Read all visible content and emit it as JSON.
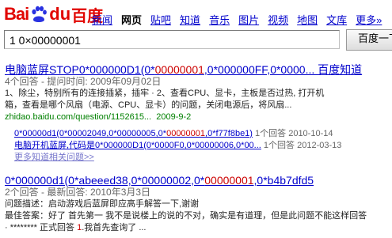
{
  "logo": {
    "bai": "Bai",
    "du": "du",
    "cn": "百度"
  },
  "nav": [
    "新闻",
    "网页",
    "贴吧",
    "知道",
    "音乐",
    "图片",
    "视频",
    "地图",
    "文库",
    "更多»"
  ],
  "nav_active": "网页",
  "search": {
    "value": "1 0×00000001",
    "button": "百度一下"
  },
  "result1": {
    "title_pre": "电脑蓝屏STOP0*000000D1(0*",
    "title_red": "00000001",
    "title_post": ",0*000000FF,0*0000... 百度知道",
    "meta": "4个回答 - 提问时间: 2009年09月02日",
    "body_line1": "1、除尘，特别所有的连接插紧，插牢 · 2、查看CPU、显卡，主板是否过热, 打开机",
    "body_line2": "箱，查看是哪个风扇（电源、CPU、显卡）的问题，关闭电源后，将风扇...",
    "url": "zhidao.baidu.com/question/1152615...",
    "url_date": "2009-9-2",
    "sub1_pre": "0*00000d1(0*00002049,0*00000005,0*",
    "sub1_red": "00000001",
    "sub1_post": ",0*f77f8be1)",
    "sub1_meta": "1个回答 2010-10-14",
    "sub2_pre": "电脑开机蓝屏,代码是0*000000D1(0*0000F0,0*00000006,0*00...",
    "sub2_meta": "1个回答 2012-03-13",
    "more": "更多知道相关问题>>"
  },
  "result2": {
    "title_pre": "0*000000d1(0*abeeed38,0*00000002,0*",
    "title_red": "00000001",
    "title_post": ",0*b4b7dfd5",
    "meta": "2个回答 - 最新回答: 2010年3月3日",
    "line1": "问题描述：启动游戏后蓝屏即应高手解答一下,谢谢",
    "line2": "最佳答案：好了 首先第一 我不是说楼上的说的不对，确实是有道理，但是此问题不能这样回答",
    "line3_pre": "· ******** 正式回答 ",
    "line3_red": "1",
    "line3_post": ".我首先查询了 ..."
  }
}
